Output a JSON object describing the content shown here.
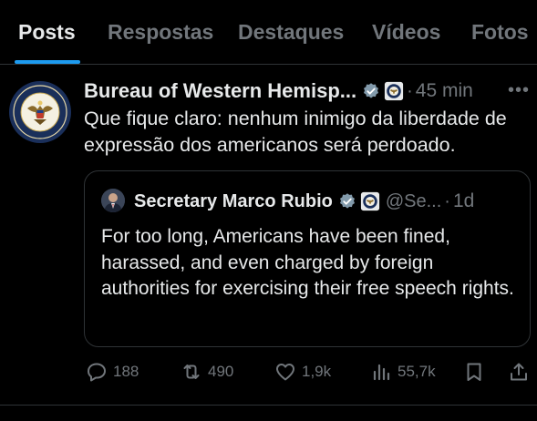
{
  "tabs": [
    {
      "label": "Posts",
      "active": true
    },
    {
      "label": "Respostas"
    },
    {
      "label": "Destaques"
    },
    {
      "label": "Vídeos"
    },
    {
      "label": "Fotos"
    }
  ],
  "post": {
    "author": "Bureau of Western Hemisp...",
    "time": "45 min",
    "text": "Que fique claro: nenhum inimigo da liberdade de expressão dos americanos será perdoado.",
    "avatar_icon": "department-of-state-seal-icon"
  },
  "quote": {
    "author": "Secretary Marco Rubio",
    "handle": "@Se...",
    "time": "1d",
    "text": "For too long, Americans have been fined, harassed, and even charged by foreign authorities for exercising their free speech rights."
  },
  "actions": {
    "replies": "188",
    "reposts": "490",
    "likes": "1,9k",
    "views": "55,7k"
  },
  "colors": {
    "background": "#000000",
    "text": "#e7e9ea",
    "muted": "#71767b",
    "accent": "#1d9bf0",
    "verified": "#829aab",
    "border": "#2f3336"
  }
}
